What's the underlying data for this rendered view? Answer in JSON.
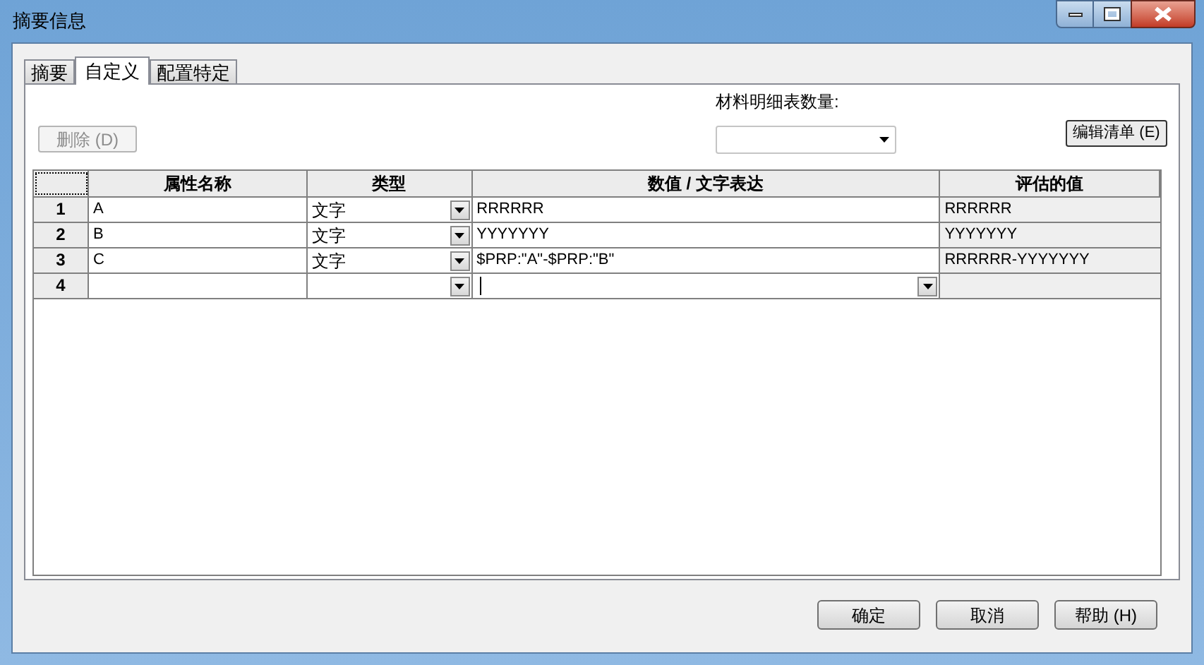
{
  "window": {
    "title": "摘要信息"
  },
  "tabs": [
    {
      "label": "摘要",
      "selected": false
    },
    {
      "label": "自定义",
      "selected": true
    },
    {
      "label": "配置特定",
      "selected": false
    }
  ],
  "delete_button": {
    "label": "删除 (D)",
    "disabled": true
  },
  "bom_quantity": {
    "label": "材料明细表数量:"
  },
  "edit_list_button": {
    "label": "编辑清单 (E)"
  },
  "table": {
    "columns": [
      "属性名称",
      "类型",
      "数值 / 文字表达",
      "评估的值"
    ],
    "rows": [
      {
        "number": "1",
        "name": "A",
        "type": "文字",
        "value": "RRRRRR",
        "evaluated": "RRRRRR",
        "editing": false
      },
      {
        "number": "2",
        "name": "B",
        "type": "文字",
        "value": "YYYYYYY",
        "evaluated": "YYYYYYY",
        "editing": false
      },
      {
        "number": "3",
        "name": "C",
        "type": "文字",
        "value": "$PRP:\"A\"-$PRP:\"B\"",
        "evaluated": "RRRRRR-YYYYYYY",
        "editing": false
      },
      {
        "number": "4",
        "name": "",
        "type": "",
        "value": "",
        "evaluated": "",
        "editing": true
      }
    ]
  },
  "buttons": [
    "确定",
    "取消",
    "帮助 (H)"
  ]
}
